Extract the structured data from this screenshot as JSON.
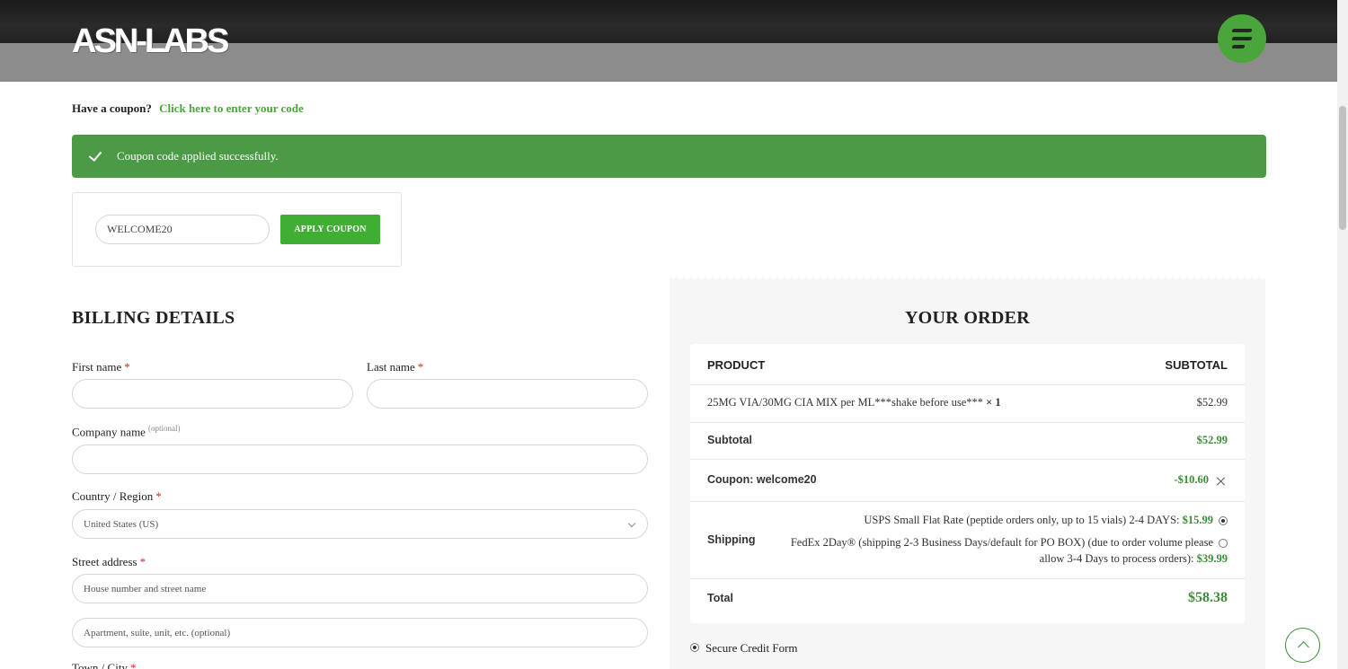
{
  "header": {
    "logo_text": "ASN-LABS"
  },
  "coupon": {
    "prompt": "Have a coupon?",
    "link": "Click here to enter your code",
    "success_message": "Coupon code applied successfully.",
    "input_value": "WELCOME20",
    "apply_label": "APPLY COUPON"
  },
  "billing": {
    "title": "BILLING DETAILS",
    "first_name_label": "First name",
    "last_name_label": "Last name",
    "company_label": "Company name",
    "optional": "(optional)",
    "country_label": "Country / Region",
    "country_value": "United States (US)",
    "street_label": "Street address",
    "street_placeholder": "House number and street name",
    "street2_placeholder": "Apartment, suite, unit, etc. (optional)",
    "town_label": "Town / City",
    "required_mark": "*"
  },
  "order": {
    "title": "YOUR ORDER",
    "col_product": "PRODUCT",
    "col_subtotal": "SUBTOTAL",
    "item_name": "25MG VIA/30MG CIA MIX per ML***shake before use***",
    "item_qty": "× 1",
    "item_price": "$52.99",
    "subtotal_label": "Subtotal",
    "subtotal_value": "$52.99",
    "coupon_label": "Coupon: welcome20",
    "coupon_value": "-$10.60",
    "shipping_label": "Shipping",
    "ship_option_1_text": "USPS Small Flat Rate (peptide orders only, up to 15 vials) 2-4 DAYS:",
    "ship_option_1_price": "$15.99",
    "ship_option_2_line1": "FedEx 2Day® (shipping 2-3 Business Days/default for PO BOX) (due to order volume please",
    "ship_option_2_line2": "allow 3-4 Days to process orders):",
    "ship_option_2_price": "$39.99",
    "total_label": "Total",
    "total_value": "$58.38"
  },
  "payment": {
    "option_label": "Secure Credit Form"
  },
  "colors": {
    "accent": "#4aa63a",
    "success_bar": "#4a9a46",
    "price_green": "#3d8c38"
  }
}
